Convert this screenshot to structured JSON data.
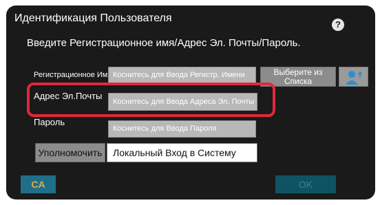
{
  "dialog": {
    "title": "Идентификация Пользователя",
    "help_icon": "question-icon",
    "instruction": "Введите Регистрационное имя/Адрес Эл. Почты/Пароль.",
    "login_name": {
      "label": "Регистрационное Имя",
      "placeholder": "Коснитесь для Ввода Регистр. Имени"
    },
    "email": {
      "label": "Адрес Эл.Почты",
      "placeholder": "Коснитесь для Ввода Адреса Эл. Почты"
    },
    "password": {
      "label": "Пароль",
      "placeholder": "Коснитесь для Ввода Пароля"
    },
    "select_list_button": "Выберите из Списка",
    "user_icon": "user-add-icon",
    "authority_button": "Уполномочить",
    "login_method": "Локальный Вход в Систему",
    "ca_button": "CA",
    "ok_button": "OK"
  },
  "colors": {
    "background": "#1a1a1a",
    "highlight": "#e0283c",
    "ca_text": "#e0ad3a",
    "ok_bg": "#0f5363"
  }
}
